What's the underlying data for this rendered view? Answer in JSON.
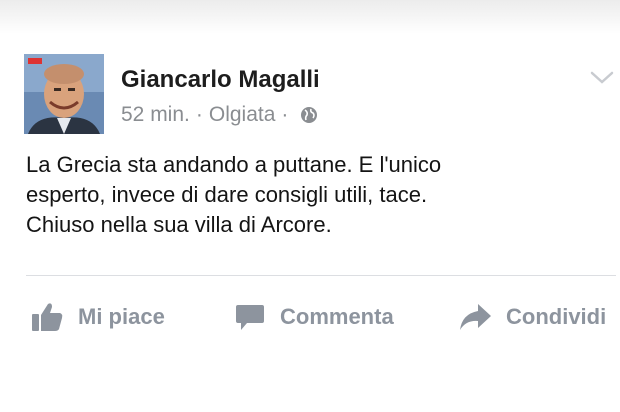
{
  "post": {
    "author": "Giancarlo Magalli",
    "time": "52 min.",
    "location": "Olgiata",
    "separator": "·",
    "privacy_icon": "globe-icon",
    "message_lines": [
      "La Grecia sta andando a puttane. E l'unico",
      "esperto, invece di dare consigli utili, tace.",
      "Chiuso nella sua villa di Arcore."
    ]
  },
  "actions": {
    "like_label": "Mi piace",
    "comment_label": "Commenta",
    "share_label": "Condividi"
  },
  "colors": {
    "author_text": "#1d1d1d",
    "meta_text": "#8a8d91",
    "action_text": "#8d949e",
    "divider": "#dcdee2"
  }
}
